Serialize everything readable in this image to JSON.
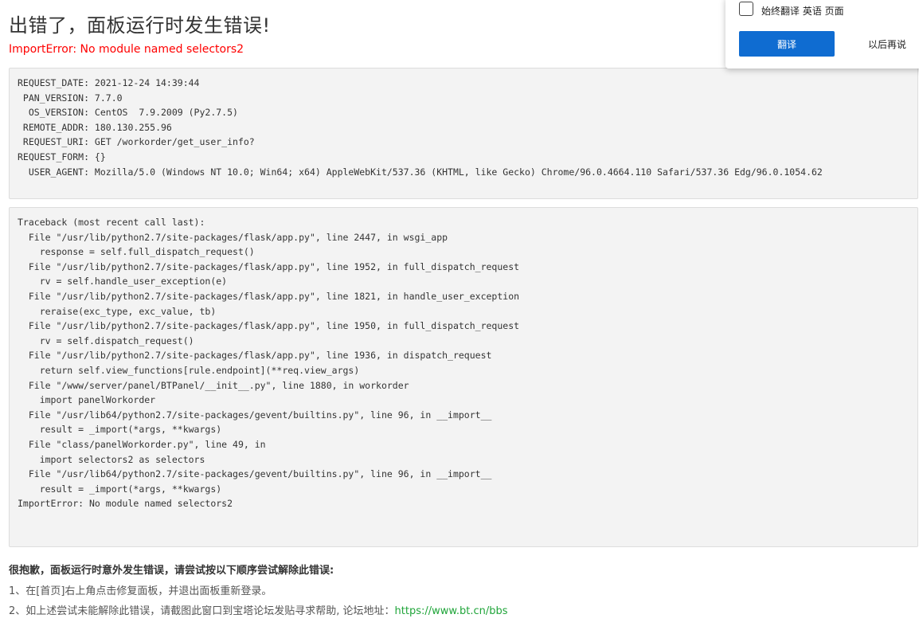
{
  "header": {
    "title": "出错了，面板运行时发生错误!",
    "error_message": "ImportError: No module named selectors2"
  },
  "request_info": {
    "lines": [
      "REQUEST_DATE: 2021-12-24 14:39:44",
      " PAN_VERSION: 7.7.0",
      "  OS_VERSION: CentOS  7.9.2009 (Py2.7.5)",
      " REMOTE_ADDR: 180.130.255.96",
      " REQUEST_URI: GET /workorder/get_user_info?",
      "REQUEST_FORM: {}",
      "  USER_AGENT: Mozilla/5.0 (Windows NT 10.0; Win64; x64) AppleWebKit/537.36 (KHTML, like Gecko) Chrome/96.0.4664.110 Safari/537.36 Edg/96.0.1054.62"
    ]
  },
  "traceback": {
    "lines": [
      "Traceback (most recent call last):",
      "  File \"/usr/lib/python2.7/site-packages/flask/app.py\", line 2447, in wsgi_app",
      "    response = self.full_dispatch_request()",
      "  File \"/usr/lib/python2.7/site-packages/flask/app.py\", line 1952, in full_dispatch_request",
      "    rv = self.handle_user_exception(e)",
      "  File \"/usr/lib/python2.7/site-packages/flask/app.py\", line 1821, in handle_user_exception",
      "    reraise(exc_type, exc_value, tb)",
      "  File \"/usr/lib/python2.7/site-packages/flask/app.py\", line 1950, in full_dispatch_request",
      "    rv = self.dispatch_request()",
      "  File \"/usr/lib/python2.7/site-packages/flask/app.py\", line 1936, in dispatch_request",
      "    return self.view_functions[rule.endpoint](**req.view_args)",
      "  File \"/www/server/panel/BTPanel/__init__.py\", line 1880, in workorder",
      "    import panelWorkorder",
      "  File \"/usr/lib64/python2.7/site-packages/gevent/builtins.py\", line 96, in __import__",
      "    result = _import(*args, **kwargs)",
      "  File \"class/panelWorkorder.py\", line 49, in",
      "    import selectors2 as selectors",
      "  File \"/usr/lib64/python2.7/site-packages/gevent/builtins.py\", line 96, in __import__",
      "    result = _import(*args, **kwargs)",
      "ImportError: No module named selectors2"
    ]
  },
  "help": {
    "title": "很抱歉，面板运行时意外发生错误，请尝试按以下顺序尝试解除此错误:",
    "step1": "1、在[首页]右上角点击修复面板，并退出面板重新登录。",
    "step2_text": "2、如上述尝试未能解除此错误，请截图此窗口到宝塔论坛发贴寻求帮助, 论坛地址：",
    "forum_link": "https://www.bt.cn/bbs"
  },
  "translate_popup": {
    "checkbox_label": "始终翻译 英语 页面",
    "translate_button": "翻译",
    "later_button": "以后再说",
    "checked": false
  },
  "colors": {
    "error": "#ff0000",
    "link": "#20a53a",
    "primary_button": "#0f6cd1",
    "code_background": "#f3f3f3"
  }
}
